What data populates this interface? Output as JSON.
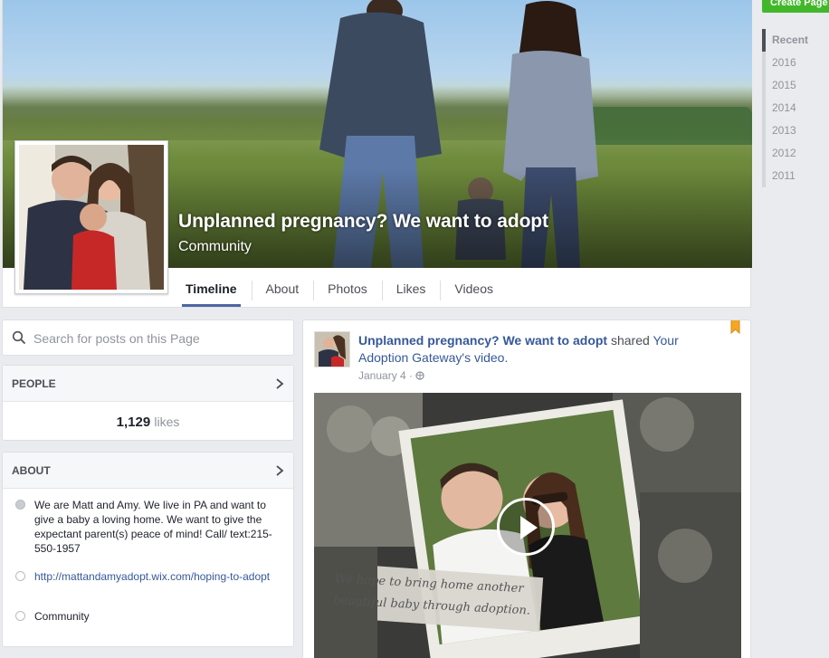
{
  "create_page": {
    "label": "Create Page"
  },
  "page": {
    "name": "Unplanned pregnancy? We want to adopt",
    "category": "Community"
  },
  "tabs": [
    {
      "label": "Timeline",
      "active": true
    },
    {
      "label": "About"
    },
    {
      "label": "Photos"
    },
    {
      "label": "Likes"
    },
    {
      "label": "Videos"
    }
  ],
  "years": [
    "Recent",
    "2016",
    "2015",
    "2014",
    "2013",
    "2012",
    "2011"
  ],
  "search": {
    "placeholder": "Search for posts on this Page"
  },
  "people": {
    "title": "PEOPLE",
    "likes_count": "1,129",
    "likes_label": "likes"
  },
  "about": {
    "title": "ABOUT",
    "description": "We are Matt and Amy. We live in PA and want to give a baby a loving home. We want to give the expectant parent(s) peace of mind! Call/ text:215-550-1957",
    "website": "http://mattandamyadopt.wix.com/hoping-to-adopt",
    "category": "Community"
  },
  "post": {
    "author": "Unplanned pregnancy? We want to adopt",
    "shared_text": "shared",
    "source": "Your Adoption Gateway",
    "source_suffix": "'s",
    "object": "video.",
    "date": "January 4",
    "separator": "·",
    "video_caption": "We hope to bring home another beautiful baby through adoption."
  },
  "colors": {
    "link": "#365899",
    "create_button": "#42b72a",
    "tab_underline": "#4b67a1",
    "bookmark": "#f5a623"
  }
}
